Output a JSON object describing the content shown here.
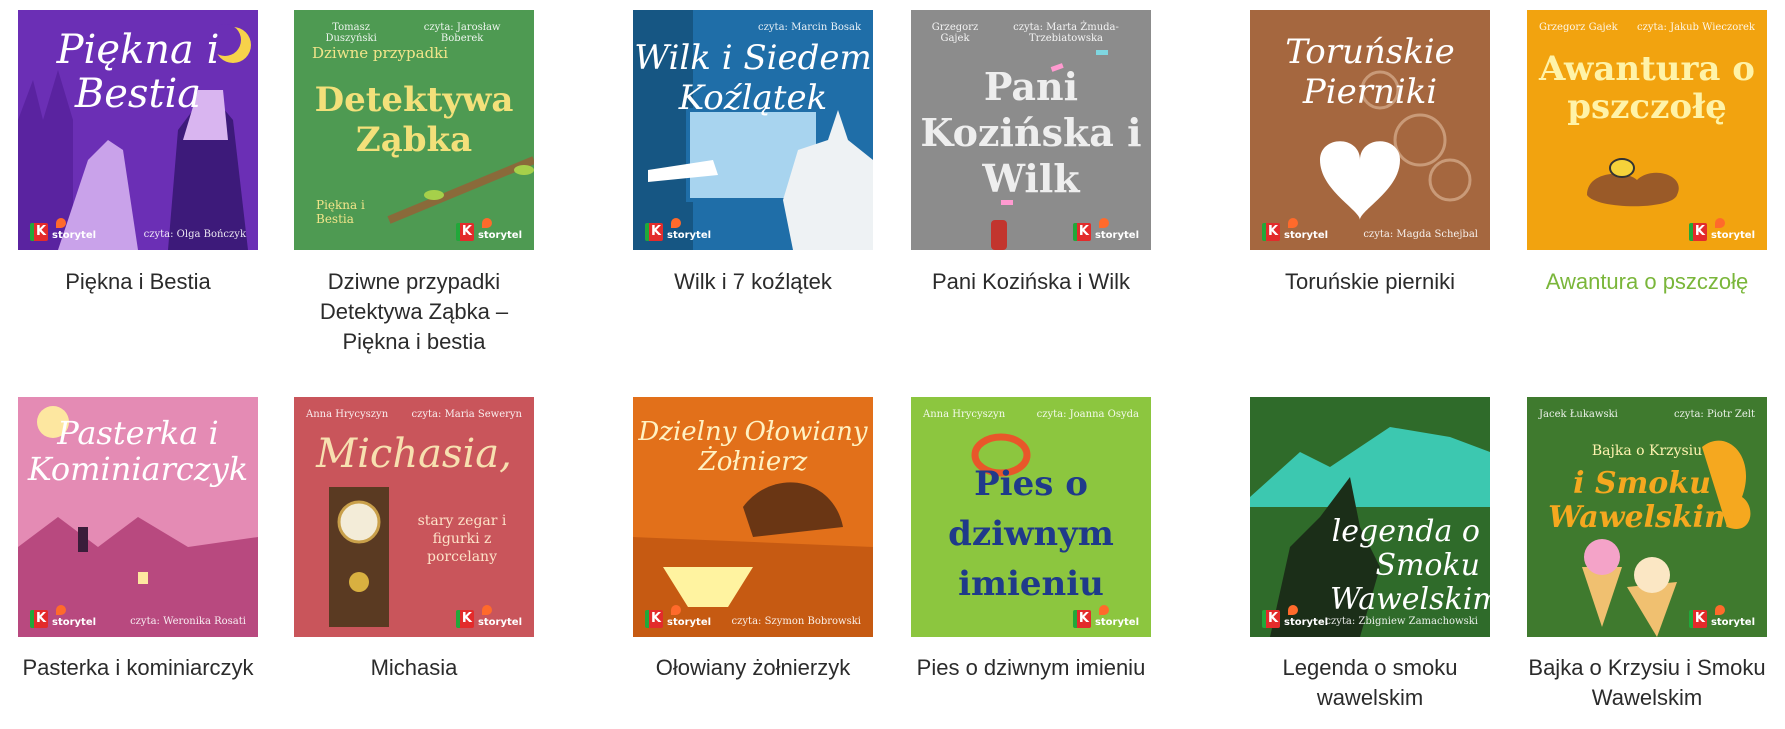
{
  "books": [
    {
      "title": "Piękna i Bestia",
      "cover_title": "Piękna i Bestia",
      "author": "",
      "narrator": "czyta: Olga Bończyk",
      "bg": "#6b2fb5",
      "highlight": false
    },
    {
      "title": "Dziwne przypadki Detektywa Ząbka – Piękna i bestia",
      "cover_title_small": "Dziwne przypadki",
      "cover_title": "Detektywa Ząbka",
      "cover_subtitle": "Piękna i Bestia",
      "author": "Tomasz Duszyński",
      "narrator": "czyta: Jarosław Boberek",
      "bg": "#4e9a52",
      "highlight": false
    },
    {
      "title": "Wilk i 7 koźlątek",
      "cover_title": "Wilk i Siedem Koźlątek",
      "author": "",
      "narrator": "czyta: Marcin Bosak",
      "bg": "#1f6ea8",
      "highlight": false
    },
    {
      "title": "Pani Kozińska i Wilk",
      "cover_title": "Pani Kozińska i Wilk",
      "author": "Grzegorz Gajek",
      "narrator": "czyta: Marta Żmuda-Trzebiatowska",
      "bg": "#8c8c8c",
      "highlight": false
    },
    {
      "title": "Toruńskie pierniki",
      "cover_title": "Toruńskie Pierniki",
      "author": "",
      "narrator": "czyta: Magda Schejbal",
      "bg": "#a5673f",
      "highlight": false
    },
    {
      "title": "Awantura o pszczołę",
      "cover_title": "Awantura o pszczołę",
      "author": "Grzegorz Gajek",
      "narrator": "czyta: Jakub Wieczorek",
      "bg": "#f2a30f",
      "highlight": true
    },
    {
      "title": "Pasterka i kominiarczyk",
      "cover_title": "Pasterka i Kominiarczyk",
      "author": "",
      "narrator": "czyta: Weronika Rosati",
      "bg": "#e48bb4",
      "highlight": false
    },
    {
      "title": "Michasia",
      "cover_title": "Michasia,",
      "cover_subtitle": "stary zegar i figurki z porcelany",
      "author": "Anna Hrycyszyn",
      "narrator": "czyta: Maria Seweryn",
      "bg": "#c9555b",
      "highlight": false
    },
    {
      "title": "Ołowiany żołnierzyk",
      "cover_title": "Dzielny Ołowiany Żołnierz",
      "author": "",
      "narrator": "czyta: Szymon Bobrowski",
      "bg": "#e2701a",
      "highlight": false
    },
    {
      "title": "Pies o dziwnym imieniu",
      "cover_title": "Pies o dziwnym imieniu",
      "author": "Anna Hrycyszyn",
      "narrator": "czyta: Joanna Osyda",
      "bg": "#8cc63f",
      "highlight": false
    },
    {
      "title": "Legenda o smoku wawelskim",
      "cover_title": "legenda o Smoku Wawelskim",
      "author": "",
      "narrator": "czyta: Zbigniew Zamachowski",
      "bg": "#2f6b2a",
      "highlight": false
    },
    {
      "title": "Bajka o Krzysiu i Smoku Wawelskim",
      "cover_title_small": "Bajka o Krzysiu",
      "cover_title": "i Smoku Wawelskim",
      "author": "Jacek Łukawski",
      "narrator": "czyta: Piotr Zelt",
      "bg": "#3f7a2e",
      "highlight": false
    }
  ],
  "logo": {
    "k": "K",
    "storytel": "storytel"
  }
}
